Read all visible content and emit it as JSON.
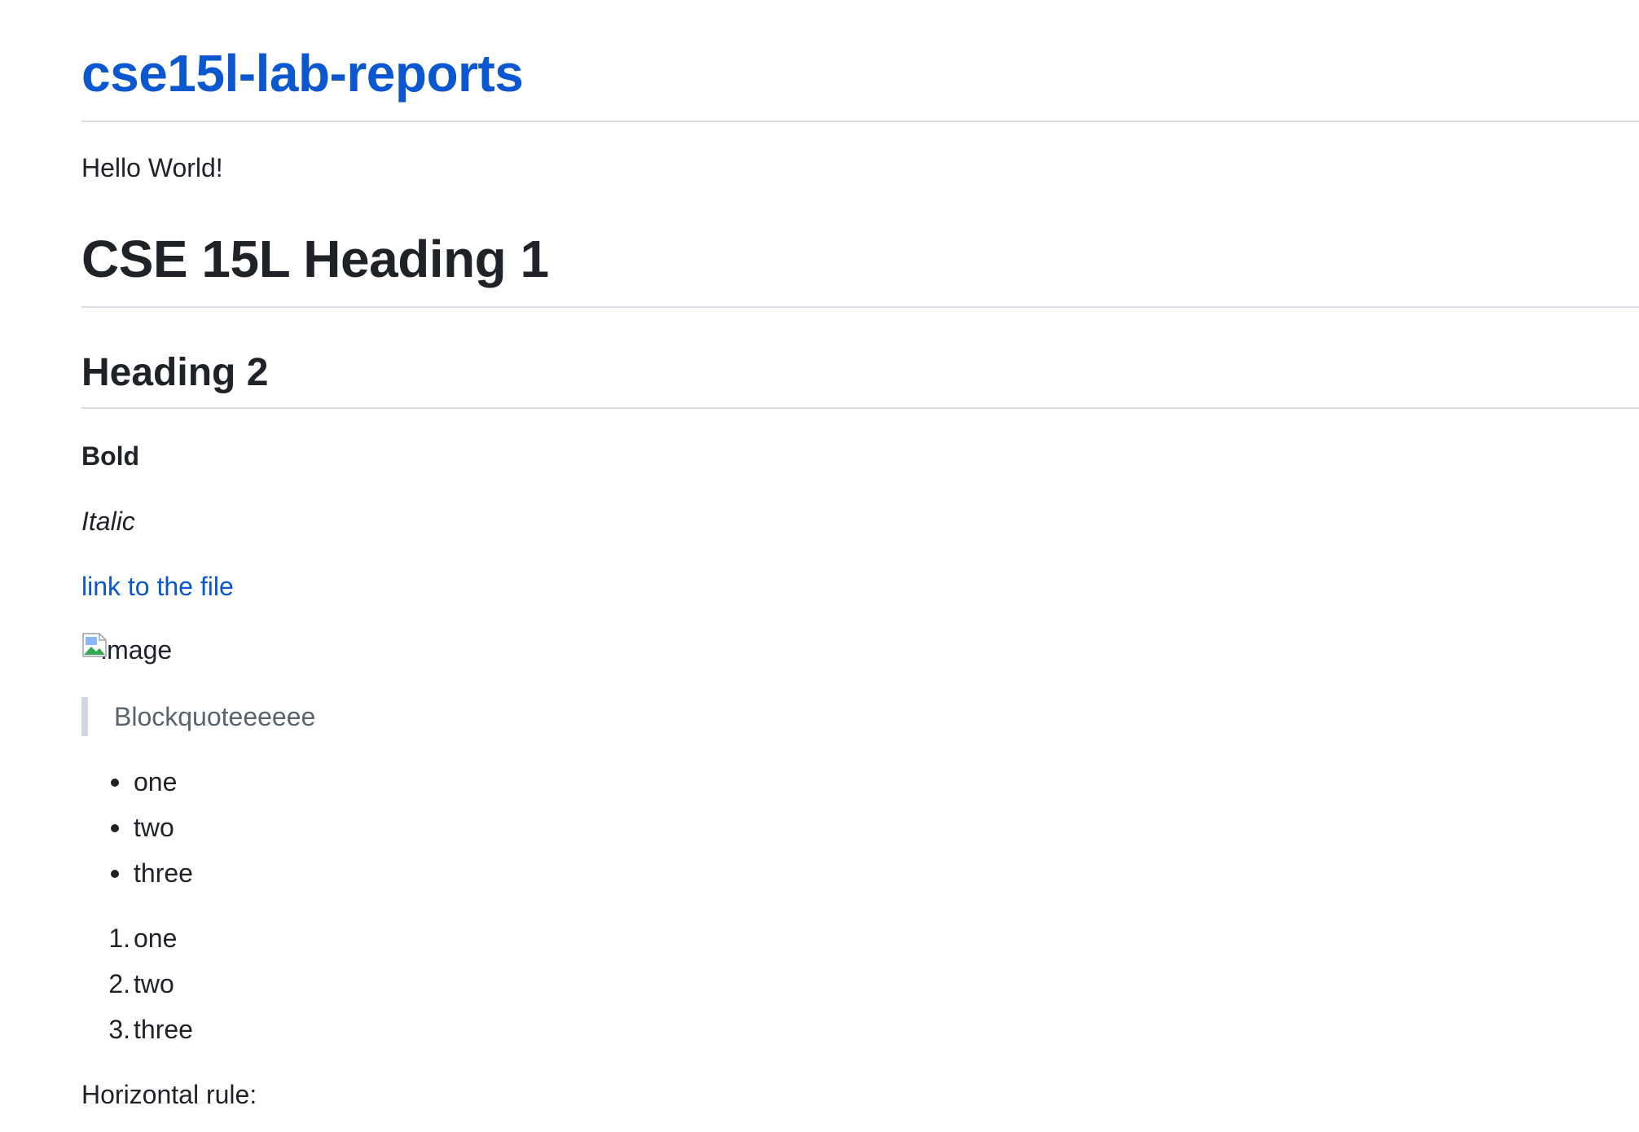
{
  "header": {
    "title": "cse15l-lab-reports"
  },
  "content": {
    "intro": "Hello World!",
    "heading1": "CSE 15L Heading 1",
    "heading2": "Heading 2",
    "bold": "Bold",
    "italic": "Italic",
    "link": "link to the file",
    "image_alt": "image",
    "blockquote": "Blockquoteeeeee",
    "unordered_list": [
      "one",
      "two",
      "three"
    ],
    "ordered_list": [
      "one",
      "two",
      "three"
    ],
    "ordered_markers": [
      "1.",
      "2.",
      "3."
    ],
    "horizontal_rule_label": "Horizontal rule:"
  },
  "colors": {
    "link": "#0b57d0",
    "text": "#1f2328",
    "blockquote_text": "#59636e",
    "blockquote_border": "#d0d7de",
    "rule": "#d8dee4"
  },
  "icons": {
    "broken_image": "broken-image-icon"
  }
}
